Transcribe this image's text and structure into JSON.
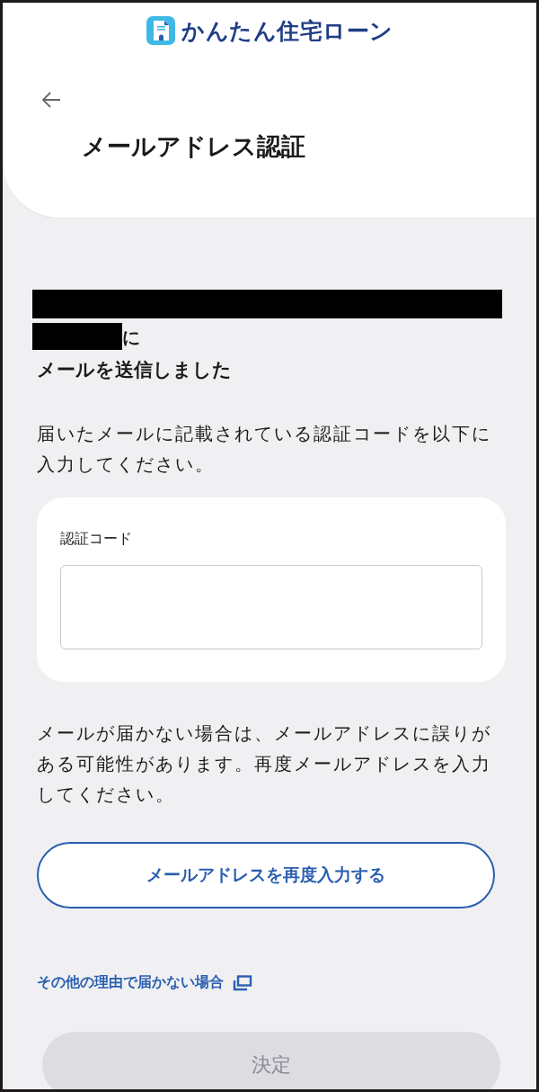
{
  "header": {
    "logo_text": "かんたん住宅ローン",
    "title": "メールアドレス認証"
  },
  "recipient": {
    "redacted": true,
    "suffix": "に",
    "heading": "メールを送信しました"
  },
  "instruction": "届いたメールに記載されている認証コードを以下に入力してください。",
  "code_field": {
    "label": "認証コード"
  },
  "note": "メールが届かない場合は、メールアドレスに誤りがある可能性があります。再度メールアドレスを入力してください。",
  "reenter_button": "メールアドレスを再度入力する",
  "help_link": "その他の理由で届かない場合",
  "submit_button": {
    "label": "決定",
    "disabled": true
  }
}
